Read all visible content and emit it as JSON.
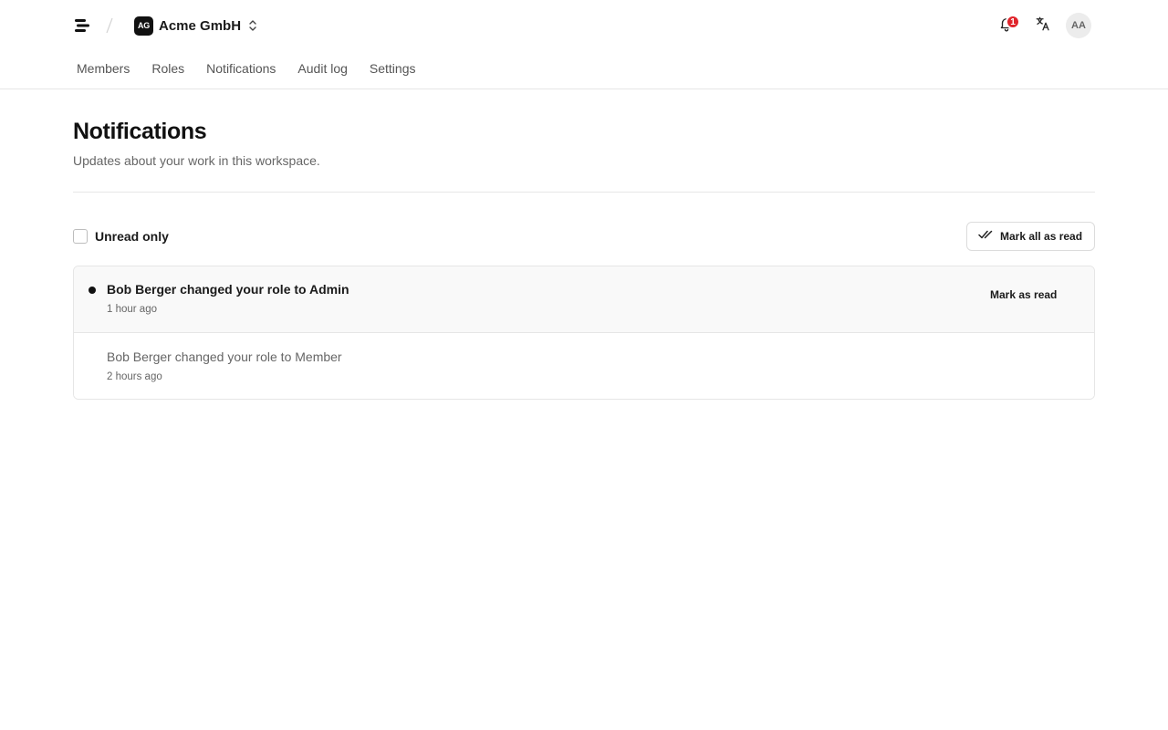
{
  "header": {
    "org_initials": "AG",
    "org_name": "Acme GmbH",
    "notification_count": "1",
    "user_initials": "AA",
    "icons": [
      "menu-logo-icon",
      "chevron-updown-icon",
      "bell-icon",
      "translate-icon"
    ]
  },
  "nav": {
    "tabs": [
      {
        "label": "Members"
      },
      {
        "label": "Roles"
      },
      {
        "label": "Notifications"
      },
      {
        "label": "Audit log"
      },
      {
        "label": "Settings"
      }
    ]
  },
  "page": {
    "title": "Notifications",
    "subtitle": "Updates about your work in this workspace."
  },
  "toolbar": {
    "filter_label": "Unread only",
    "filter_checked": false,
    "mark_all_label": "Mark all as read"
  },
  "notifications": [
    {
      "title": "Bob Berger changed your role to Admin",
      "time": "1 hour ago",
      "unread": true,
      "action_label": "Mark as read"
    },
    {
      "title": "Bob Berger changed your role to Member",
      "time": "2 hours ago",
      "unread": false
    }
  ],
  "colors": {
    "badge": "#e0242b",
    "text_primary": "#1a1a1a",
    "text_muted": "#666666",
    "border": "#e6e6e6",
    "unread_row_bg": "#f9f9f9"
  }
}
